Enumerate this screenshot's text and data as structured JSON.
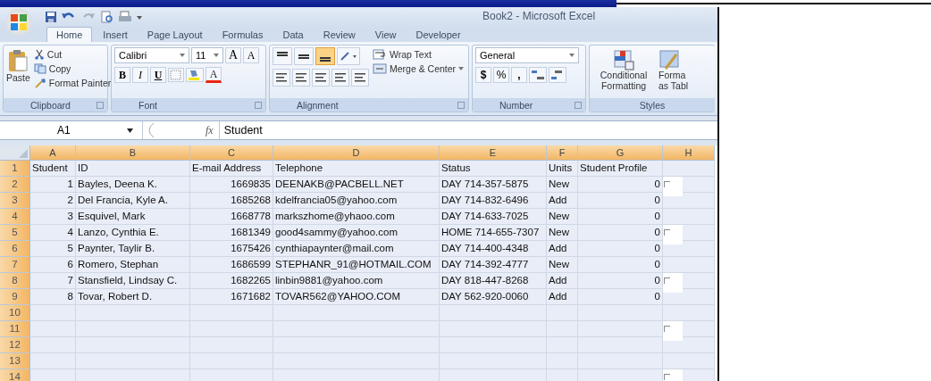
{
  "window": {
    "title": "Book2 - Microsoft Excel"
  },
  "tabs": [
    {
      "label": "Home",
      "selected": true
    },
    {
      "label": "Insert",
      "selected": false
    },
    {
      "label": "Page Layout",
      "selected": false
    },
    {
      "label": "Formulas",
      "selected": false
    },
    {
      "label": "Data",
      "selected": false
    },
    {
      "label": "Review",
      "selected": false
    },
    {
      "label": "View",
      "selected": false
    },
    {
      "label": "Developer",
      "selected": false
    }
  ],
  "clipboard": {
    "title": "Clipboard",
    "paste": "Paste",
    "cut": "Cut",
    "copy": "Copy",
    "format_painter": "Format Painter"
  },
  "font": {
    "title": "Font",
    "font_name": "Calibri",
    "font_size": "11",
    "grow": "A",
    "shrink": "A",
    "bold": "B",
    "italic": "I",
    "underline": "U",
    "font_color": "A"
  },
  "alignment": {
    "title": "Alignment",
    "vertical": [
      {
        "selected": false
      },
      {
        "selected": false
      },
      {
        "selected": true
      }
    ],
    "wrap_text": "Wrap Text",
    "merge_center": "Merge & Center"
  },
  "number": {
    "title": "Number",
    "format": "General",
    "currency": "$",
    "percent": "%",
    "comma": ","
  },
  "styles": {
    "title": "Styles",
    "conditional_formatting": [
      "Conditional",
      "Formatting"
    ],
    "format_as_table": [
      "Forma",
      "as Tabl"
    ]
  },
  "formula_bar": {
    "name_box": "A1",
    "function_label": "fx",
    "content": "Student"
  },
  "columns": [
    {
      "label": "A",
      "numeric": true,
      "selected": true
    },
    {
      "label": "B",
      "numeric": false,
      "selected": true
    },
    {
      "label": "C",
      "numeric": true,
      "selected": true
    },
    {
      "label": "D",
      "numeric": false,
      "selected": true
    },
    {
      "label": "E",
      "numeric": false,
      "selected": true
    },
    {
      "label": "F",
      "numeric": false,
      "selected": true
    },
    {
      "label": "G",
      "numeric": true,
      "selected": true
    },
    {
      "label": "H",
      "numeric": false,
      "selected": true
    }
  ],
  "rows": [
    {
      "number": "1",
      "kind": "header",
      "selected": true,
      "cells": [
        "Student",
        "ID",
        "E-mail Address",
        "Telephone",
        "Status",
        "Units",
        "Student Profile",
        ""
      ]
    },
    {
      "number": "2",
      "kind": "data",
      "selected": true,
      "cells": [
        "1",
        "Bayles, Deena K.",
        "1669835",
        "DEENAKB@PACBELL.NET",
        "DAY 714-357-5875",
        "New",
        "0",
        ""
      ],
      "checkbox": {
        "checked": false
      }
    },
    {
      "number": "3",
      "kind": "data",
      "selected": true,
      "cells": [
        "2",
        "Del Francia, Kyle A.",
        "1685268",
        "kdelfrancia05@yahoo.com",
        "DAY 714-832-6496",
        "Add",
        "0",
        ""
      ]
    },
    {
      "number": "4",
      "kind": "data",
      "selected": true,
      "cells": [
        "3",
        "Esquivel, Mark",
        "1668778",
        "markszhome@yhaoo.com",
        "DAY 714-633-7025",
        "New",
        "0",
        ""
      ]
    },
    {
      "number": "5",
      "kind": "data",
      "selected": true,
      "cells": [
        "4",
        "Lanzo, Cynthia E.",
        "1681349",
        "good4sammy@yahoo.com",
        "HOME 714-655-7307",
        "New",
        "0",
        ""
      ],
      "checkbox": {
        "checked": false
      }
    },
    {
      "number": "6",
      "kind": "data",
      "selected": true,
      "cells": [
        "5",
        "Paynter, Taylir B.",
        "1675426",
        "cynthiapaynter@mail.com",
        "DAY 714-400-4348",
        "Add",
        "0",
        ""
      ]
    },
    {
      "number": "7",
      "kind": "data",
      "selected": true,
      "cells": [
        "6",
        "Romero, Stephan",
        "1686599",
        "STEPHANR_91@HOTMAIL.COM",
        "DAY 714-392-4777",
        "New",
        "0",
        ""
      ]
    },
    {
      "number": "8",
      "kind": "data",
      "selected": true,
      "cells": [
        "7",
        "Stansfield, Lindsay C.",
        "1682265",
        "linbin9881@yahoo.com",
        "DAY 818-447-8268",
        "Add",
        "0",
        ""
      ],
      "checkbox": {
        "checked": false
      }
    },
    {
      "number": "9",
      "kind": "data",
      "selected": true,
      "cells": [
        "8",
        "Tovar, Robert D.",
        "1671682",
        "TOVAR562@YAHOO.COM",
        "DAY 562-920-0060",
        "Add",
        "0",
        ""
      ]
    },
    {
      "number": "10",
      "kind": "empty",
      "selected": true
    },
    {
      "number": "11",
      "kind": "empty",
      "selected": true,
      "checkbox": {
        "checked": false
      }
    },
    {
      "number": "12",
      "kind": "empty",
      "selected": true
    },
    {
      "number": "13",
      "kind": "empty",
      "selected": true
    },
    {
      "number": "14",
      "kind": "empty",
      "selected": true,
      "checkbox": {
        "checked": false
      }
    }
  ]
}
